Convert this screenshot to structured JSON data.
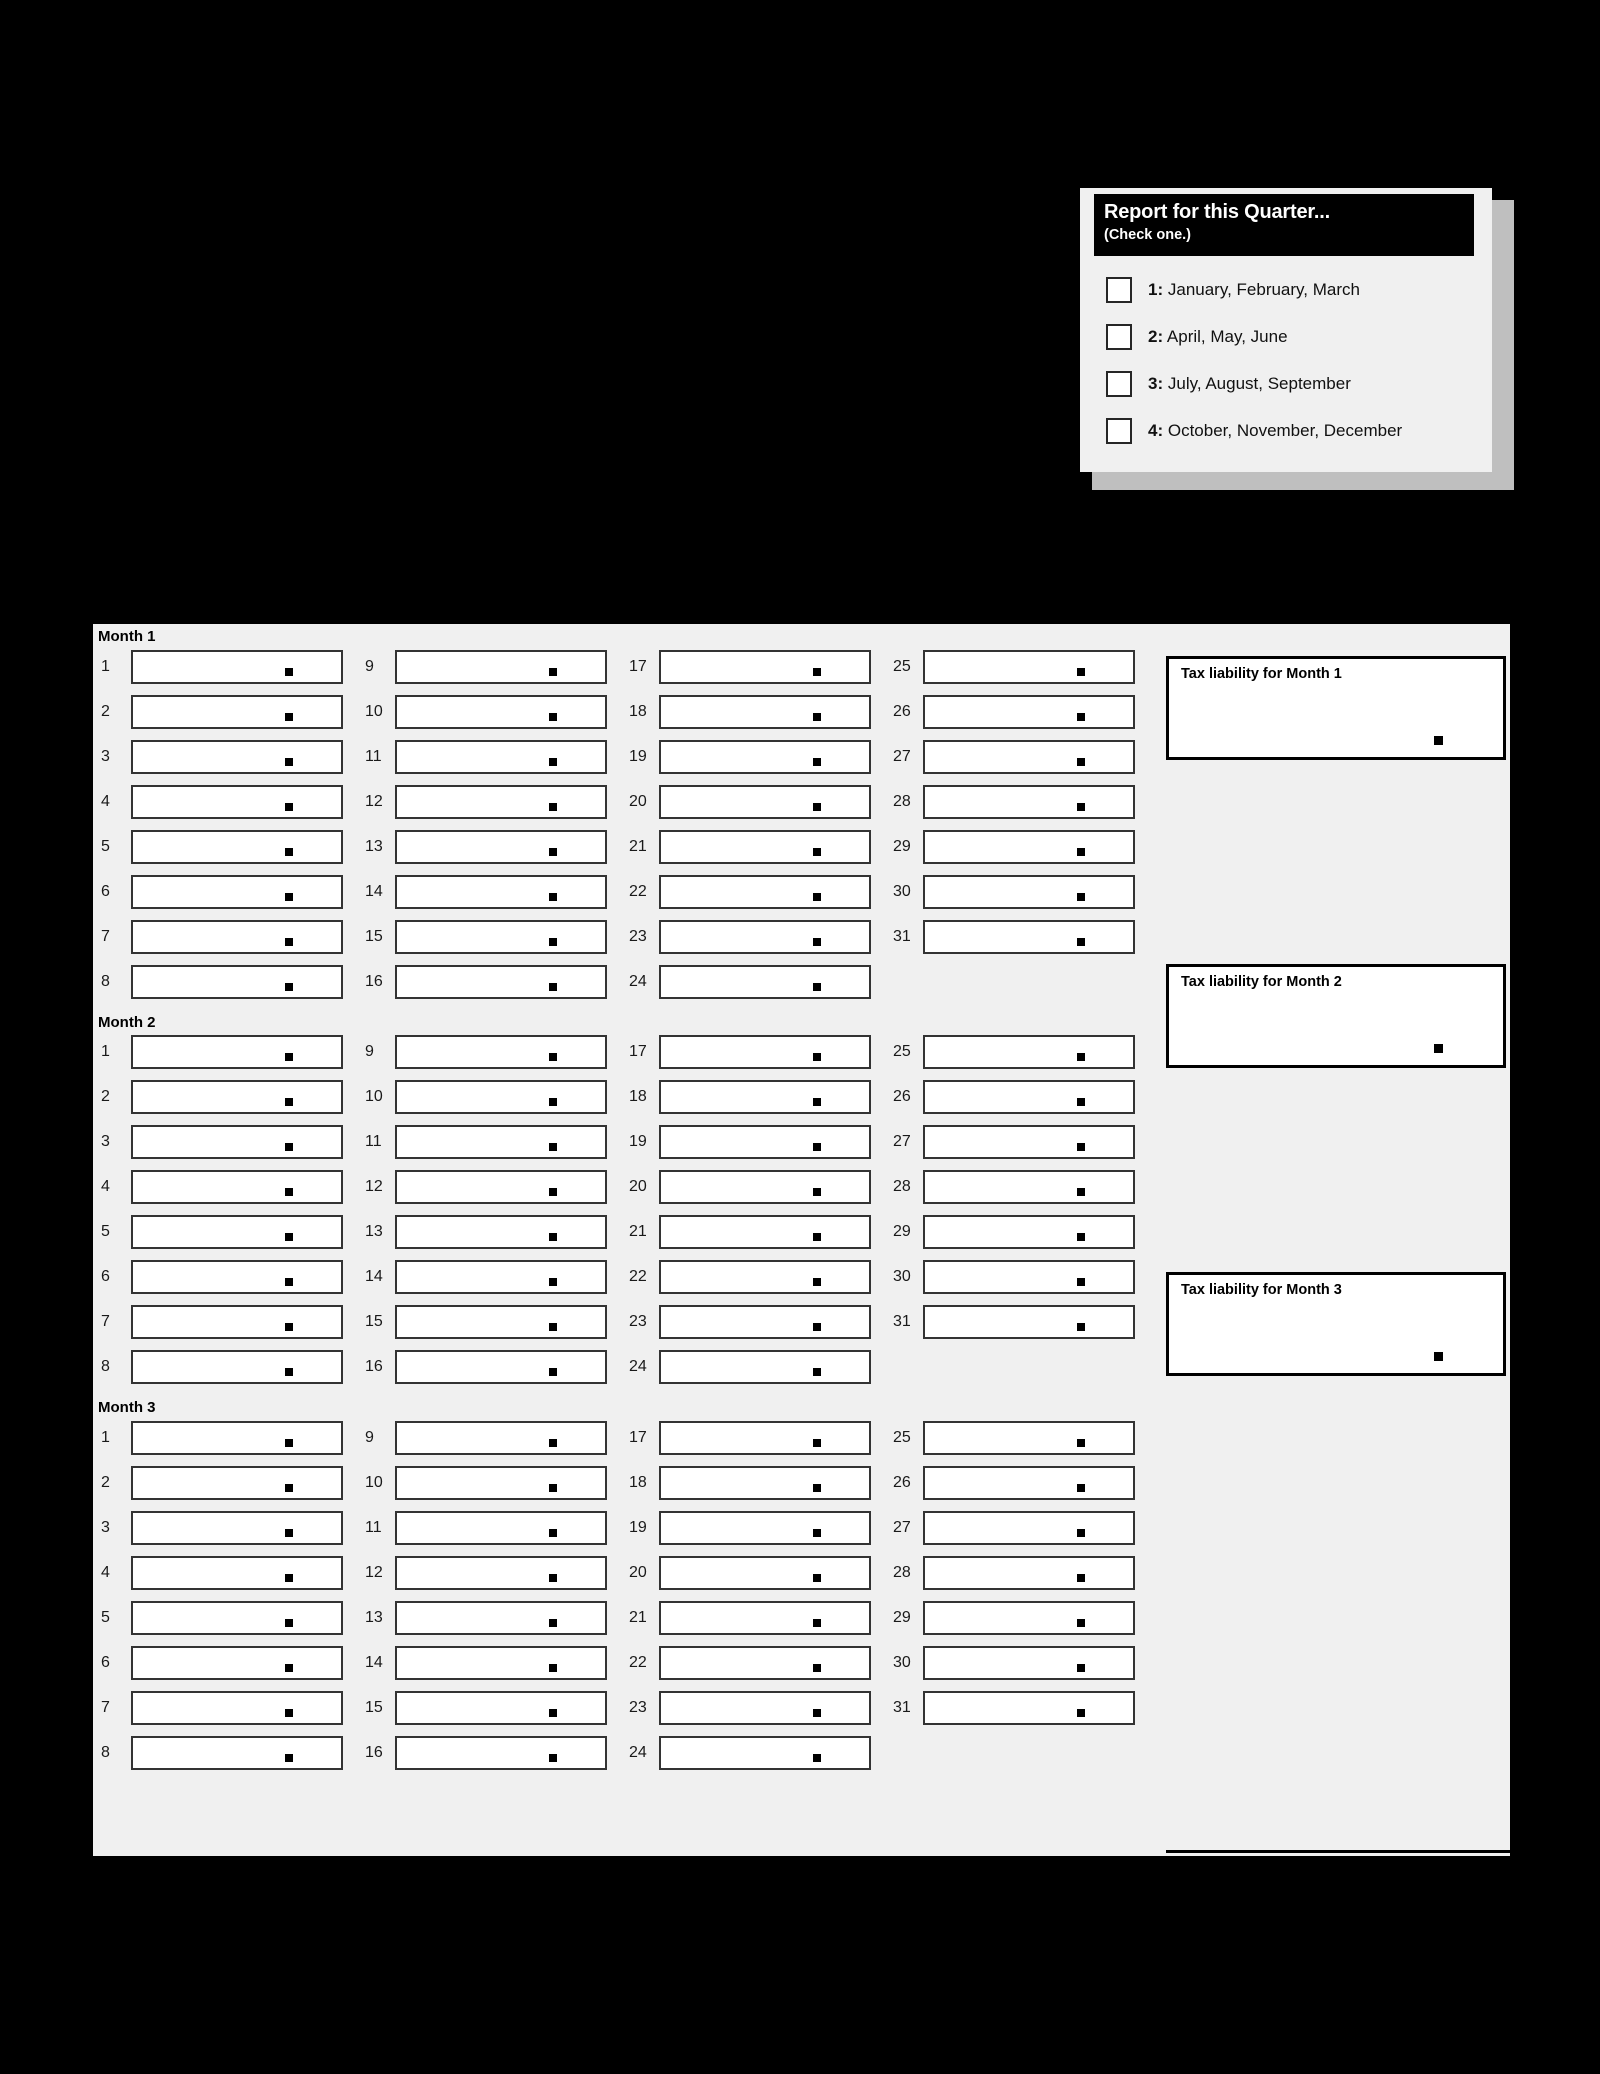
{
  "quarter_panel": {
    "title": "Report for this Quarter...",
    "subtitle": "(Check one.)",
    "options": [
      {
        "number": "1:",
        "months": "January, February, March",
        "checked": false
      },
      {
        "number": "2:",
        "months": "April, May, June",
        "checked": false
      },
      {
        "number": "3:",
        "months": "July, August, September",
        "checked": false
      },
      {
        "number": "4:",
        "months": "October, November, December",
        "checked": false
      }
    ]
  },
  "months": [
    {
      "title": "Month 1",
      "liability_label": "Tax liability for Month 1",
      "liability_value": "",
      "columns": [
        {
          "days": [
            "1",
            "2",
            "3",
            "4",
            "5",
            "6",
            "7",
            "8"
          ],
          "values": [
            "",
            "",
            "",
            "",
            "",
            "",
            "",
            ""
          ]
        },
        {
          "days": [
            "9",
            "10",
            "11",
            "12",
            "13",
            "14",
            "15",
            "16"
          ],
          "values": [
            "",
            "",
            "",
            "",
            "",
            "",
            "",
            ""
          ]
        },
        {
          "days": [
            "17",
            "18",
            "19",
            "20",
            "21",
            "22",
            "23",
            "24"
          ],
          "values": [
            "",
            "",
            "",
            "",
            "",
            "",
            "",
            ""
          ]
        },
        {
          "days": [
            "25",
            "26",
            "27",
            "28",
            "29",
            "30",
            "31"
          ],
          "values": [
            "",
            "",
            "",
            "",
            "",
            "",
            ""
          ]
        }
      ]
    },
    {
      "title": "Month 2",
      "liability_label": "Tax liability for Month 2",
      "liability_value": "",
      "columns": [
        {
          "days": [
            "1",
            "2",
            "3",
            "4",
            "5",
            "6",
            "7",
            "8"
          ],
          "values": [
            "",
            "",
            "",
            "",
            "",
            "",
            "",
            ""
          ]
        },
        {
          "days": [
            "9",
            "10",
            "11",
            "12",
            "13",
            "14",
            "15",
            "16"
          ],
          "values": [
            "",
            "",
            "",
            "",
            "",
            "",
            "",
            ""
          ]
        },
        {
          "days": [
            "17",
            "18",
            "19",
            "20",
            "21",
            "22",
            "23",
            "24"
          ],
          "values": [
            "",
            "",
            "",
            "",
            "",
            "",
            "",
            ""
          ]
        },
        {
          "days": [
            "25",
            "26",
            "27",
            "28",
            "29",
            "30",
            "31"
          ],
          "values": [
            "",
            "",
            "",
            "",
            "",
            "",
            ""
          ]
        }
      ]
    },
    {
      "title": "Month 3",
      "liability_label": "Tax liability for Month 3",
      "liability_value": "",
      "columns": [
        {
          "days": [
            "1",
            "2",
            "3",
            "4",
            "5",
            "6",
            "7",
            "8"
          ],
          "values": [
            "",
            "",
            "",
            "",
            "",
            "",
            "",
            ""
          ]
        },
        {
          "days": [
            "9",
            "10",
            "11",
            "12",
            "13",
            "14",
            "15",
            "16"
          ],
          "values": [
            "",
            "",
            "",
            "",
            "",
            "",
            "",
            ""
          ]
        },
        {
          "days": [
            "17",
            "18",
            "19",
            "20",
            "21",
            "22",
            "23",
            "24"
          ],
          "values": [
            "",
            "",
            "",
            "",
            "",
            "",
            "",
            ""
          ]
        },
        {
          "days": [
            "25",
            "26",
            "27",
            "28",
            "29",
            "30",
            "31"
          ],
          "values": [
            "",
            "",
            "",
            "",
            "",
            "",
            ""
          ]
        }
      ]
    }
  ],
  "colors": {
    "page_background": "#000000",
    "panel_background": "#f0f0f0",
    "panel_shadow": "#bfbfbf",
    "header_bar": "#000000",
    "header_text": "#ffffff",
    "field_background": "#ffffff",
    "field_border": "#333333",
    "liability_border": "#000000"
  }
}
